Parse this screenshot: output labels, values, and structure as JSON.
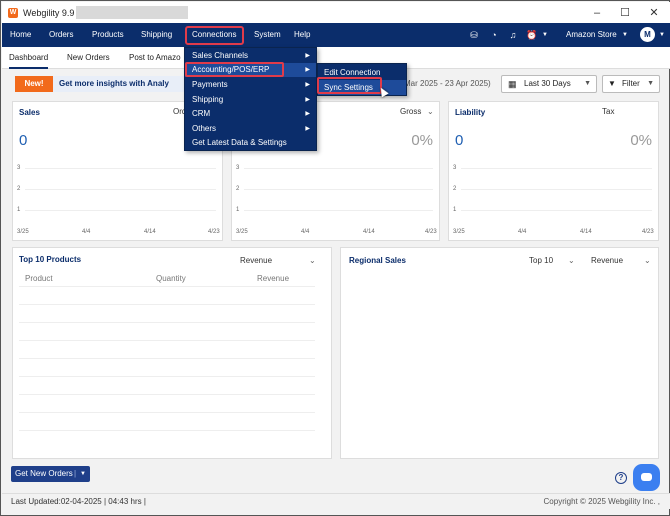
{
  "window": {
    "title": "Webgility 9.9",
    "logo_letter": "W",
    "controls": [
      "–",
      "☐",
      "✕"
    ]
  },
  "navbar": {
    "items": [
      "Home",
      "Orders",
      "Products",
      "Shipping",
      "Connections",
      "System",
      "Help"
    ],
    "store_label": "Amazon Store",
    "avatar_letter": "M",
    "icons": [
      "database-icon",
      "speedometer-icon",
      "bell-icon",
      "alarm-clock-icon"
    ]
  },
  "subtabs": [
    "Dashboard",
    "New Orders",
    "Post to Amazo"
  ],
  "banner": {
    "badge": "New!",
    "text": "Get more insights with Analy",
    "date_range": "Mar 2025 - 23 Apr 2025)",
    "period": "Last 30 Days",
    "filter": "Filter"
  },
  "cards": [
    {
      "title": "Sales",
      "metric": "Ord",
      "value": "0",
      "yticks": [
        "3",
        "2",
        "1"
      ],
      "xticks": [
        "3/25",
        "4/4",
        "4/14",
        "4/23"
      ]
    },
    {
      "title": "",
      "metric": "Gross",
      "value": "0%",
      "yticks": [
        "3",
        "2",
        "1"
      ],
      "xticks": [
        "3/25",
        "4/4",
        "4/14",
        "4/23"
      ]
    },
    {
      "title": "Liability",
      "metric": "Tax",
      "value": "0",
      "pct": "0%",
      "yticks": [
        "3",
        "2",
        "1"
      ],
      "xticks": [
        "3/25",
        "4/4",
        "4/14",
        "4/23"
      ]
    }
  ],
  "top_products": {
    "title": "Top 10 Products",
    "metric": "Revenue",
    "columns": [
      "Product",
      "Quantity",
      "Revenue"
    ]
  },
  "regional": {
    "title": "Regional Sales",
    "top": "Top 10",
    "metric": "Revenue"
  },
  "menu": {
    "items": [
      "Sales Channels",
      "Accounting/POS/ERP",
      "Payments",
      "Shipping",
      "CRM",
      "Others",
      "Get Latest Data & Settings"
    ],
    "submenu": [
      "Edit Connection",
      "Sync Settings"
    ]
  },
  "footer": {
    "get_orders": "Get New Orders",
    "last_updated": "Last Updated:02-04-2025 | 04:43 hrs |",
    "copyright": "Copyright © 2025 Webgility Inc. ,"
  }
}
